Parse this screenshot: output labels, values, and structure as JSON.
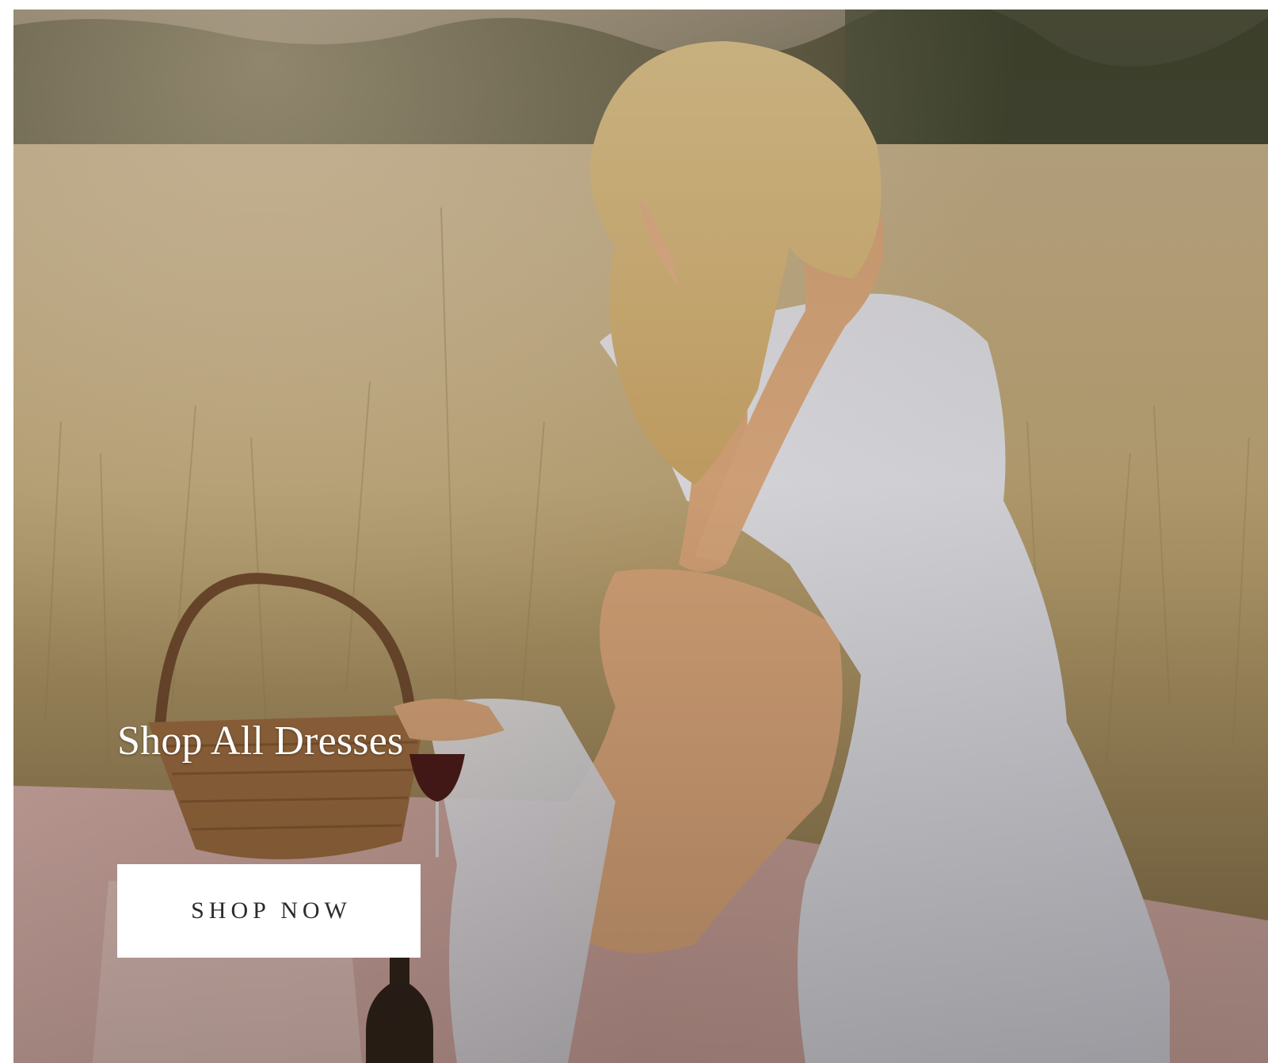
{
  "hero": {
    "heading": "Shop All Dresses",
    "cta_label": "SHOP NOW"
  },
  "colors": {
    "cta_background": "#ffffff",
    "cta_text": "#2b2b2b",
    "heading_text": "#ffffff"
  }
}
